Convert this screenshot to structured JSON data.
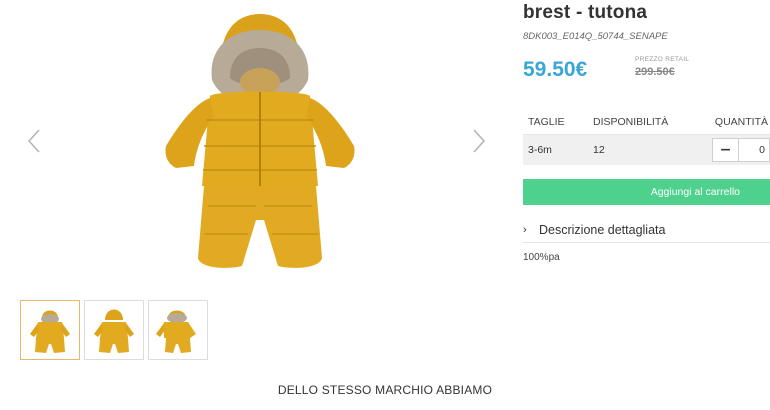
{
  "gallery": {
    "prev_label": "prev-arrow",
    "next_label": "next-arrow",
    "product_color": "#e0a91d",
    "fur_color": "#b9ad9a",
    "thumbnails": [
      {
        "name": "front-view",
        "active": true
      },
      {
        "name": "back-view",
        "active": false
      },
      {
        "name": "open-view",
        "active": false
      }
    ]
  },
  "product": {
    "title": "brest - tutona",
    "sku": "8DK003_E014Q_50744_SENAPE",
    "price": "59.50€",
    "retail_label": "PREZZO RETAIL",
    "retail_price": "299.50€",
    "price_color": "#3aa6d8"
  },
  "stock_table": {
    "headers": {
      "size": "TAGLIE",
      "availability": "DISPONIBILITÀ",
      "quantity": "QUANTITÀ"
    },
    "rows": [
      {
        "size": "3-6m",
        "availability": "12",
        "quantity": "0",
        "minus_label": "−"
      }
    ]
  },
  "cart": {
    "label": "Aggiungi al carrello",
    "color": "#4fd18e"
  },
  "details": {
    "chevron": "›",
    "label": "Descrizione dettagliata",
    "material": "100%pa"
  },
  "section": {
    "heading": "DELLO STESSO MARCHIO ABBIAMO"
  }
}
